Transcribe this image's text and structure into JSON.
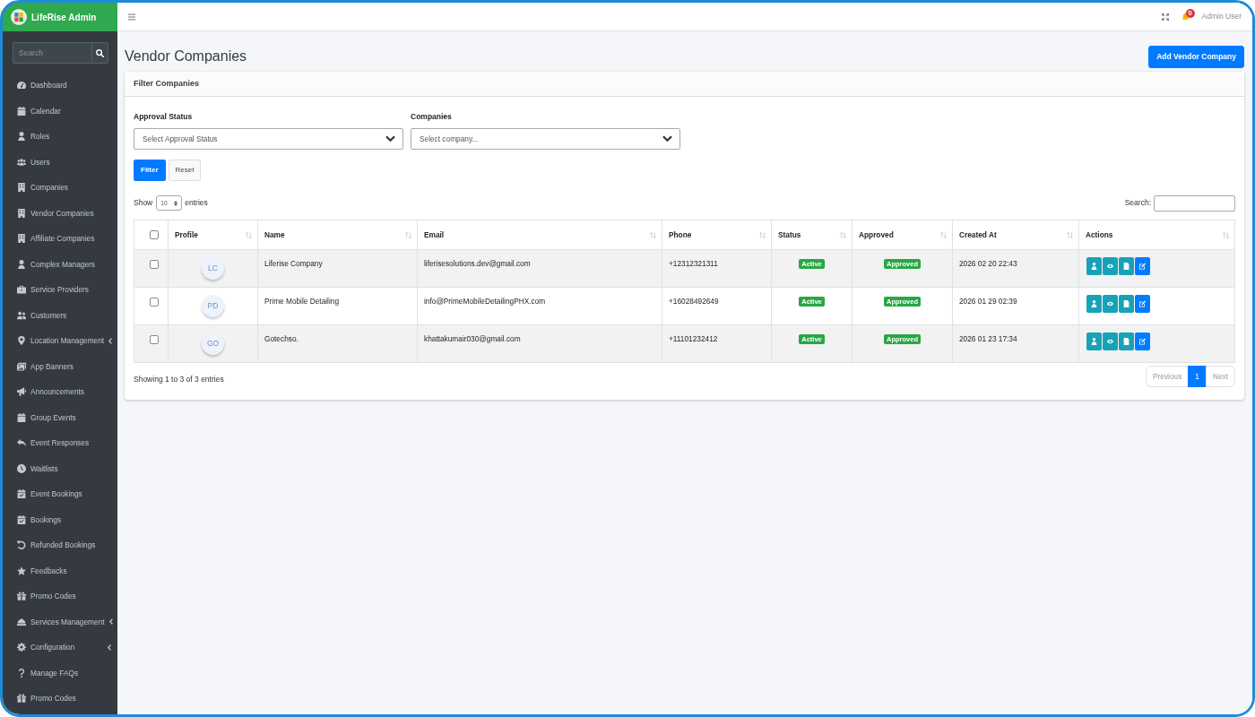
{
  "brand": {
    "name": "LifeRise Admin"
  },
  "sidebar": {
    "search": {
      "placeholder": "Search"
    },
    "items": [
      {
        "label": "Dashboard",
        "has_submenu": false
      },
      {
        "label": "Calendar",
        "has_submenu": false
      },
      {
        "label": "Roles",
        "has_submenu": false
      },
      {
        "label": "Users",
        "has_submenu": false
      },
      {
        "label": "Companies",
        "has_submenu": false
      },
      {
        "label": "Vendor Companies",
        "has_submenu": false
      },
      {
        "label": "Affiliate Companies",
        "has_submenu": false
      },
      {
        "label": "Complex Managers",
        "has_submenu": false
      },
      {
        "label": "Service Providers",
        "has_submenu": false
      },
      {
        "label": "Customers",
        "has_submenu": false
      },
      {
        "label": "Location Management",
        "has_submenu": true
      },
      {
        "label": "App Banners",
        "has_submenu": false
      },
      {
        "label": "Announcements",
        "has_submenu": false
      },
      {
        "label": "Group Events",
        "has_submenu": false
      },
      {
        "label": "Event Responses",
        "has_submenu": false
      },
      {
        "label": "Waitlists",
        "has_submenu": false
      },
      {
        "label": "Event Bookings",
        "has_submenu": false
      },
      {
        "label": "Bookings",
        "has_submenu": false
      },
      {
        "label": "Refunded Bookings",
        "has_submenu": false
      },
      {
        "label": "Feedbacks",
        "has_submenu": false
      },
      {
        "label": "Promo Codes",
        "has_submenu": false
      },
      {
        "label": "Services Management",
        "has_submenu": true
      },
      {
        "label": "Configuration",
        "has_submenu": true
      },
      {
        "label": "Manage FAQs",
        "has_submenu": false
      },
      {
        "label": "Promo Codes",
        "has_submenu": false
      }
    ]
  },
  "topbar": {
    "notification_count": "0",
    "user": "Admin User"
  },
  "page": {
    "title": "Vendor Companies",
    "add_button": "Add Vendor Company"
  },
  "filter_card": {
    "title": "Filter Companies",
    "fields": [
      {
        "label": "Approval Status",
        "placeholder": "Select Approval Status"
      },
      {
        "label": "Companies",
        "placeholder": "Select company..."
      }
    ],
    "buttons": [
      {
        "label": "Filter",
        "kind": "filter"
      },
      {
        "label": "Reset",
        "kind": "reset"
      }
    ]
  },
  "table_controls": {
    "show_label": "Show",
    "page_size": "10",
    "entries_label": "entries",
    "search_label": "Search:"
  },
  "table": {
    "select_all_checked": false,
    "columns": [
      "Profile",
      "Name",
      "Email",
      "Phone",
      "Status",
      "Approved",
      "Created At",
      "Actions"
    ],
    "rows": [
      {
        "checked": false,
        "initials": "LC",
        "name": "Liferise Company",
        "email": "liferisesolutions.dev@gmail.com",
        "phone": "+12312321311",
        "status": "Active",
        "approved": "Approved",
        "created_at": "2026 02 20 22:43"
      },
      {
        "checked": false,
        "initials": "PD",
        "name": "Prime Mobile Detailing",
        "email": "info@PrimeMobileDetailingPHX.com",
        "phone": "+16028492649",
        "status": "Active",
        "approved": "Approved",
        "created_at": "2026 01 29 02:39"
      },
      {
        "checked": false,
        "initials": "GO",
        "name": "Gotechso.",
        "email": "khattakumair030@gmail.com",
        "phone": "+11101232412",
        "status": "Active",
        "approved": "Approved",
        "created_at": "2026 01 23 17:34"
      }
    ]
  },
  "footer": {
    "info": "Showing 1 to 3 of 3 entries",
    "pagination": [
      {
        "label": "Previous",
        "selected": false,
        "disabled": true
      },
      {
        "label": "1",
        "selected": true,
        "disabled": false
      },
      {
        "label": "Next",
        "selected": false,
        "disabled": true
      }
    ]
  }
}
